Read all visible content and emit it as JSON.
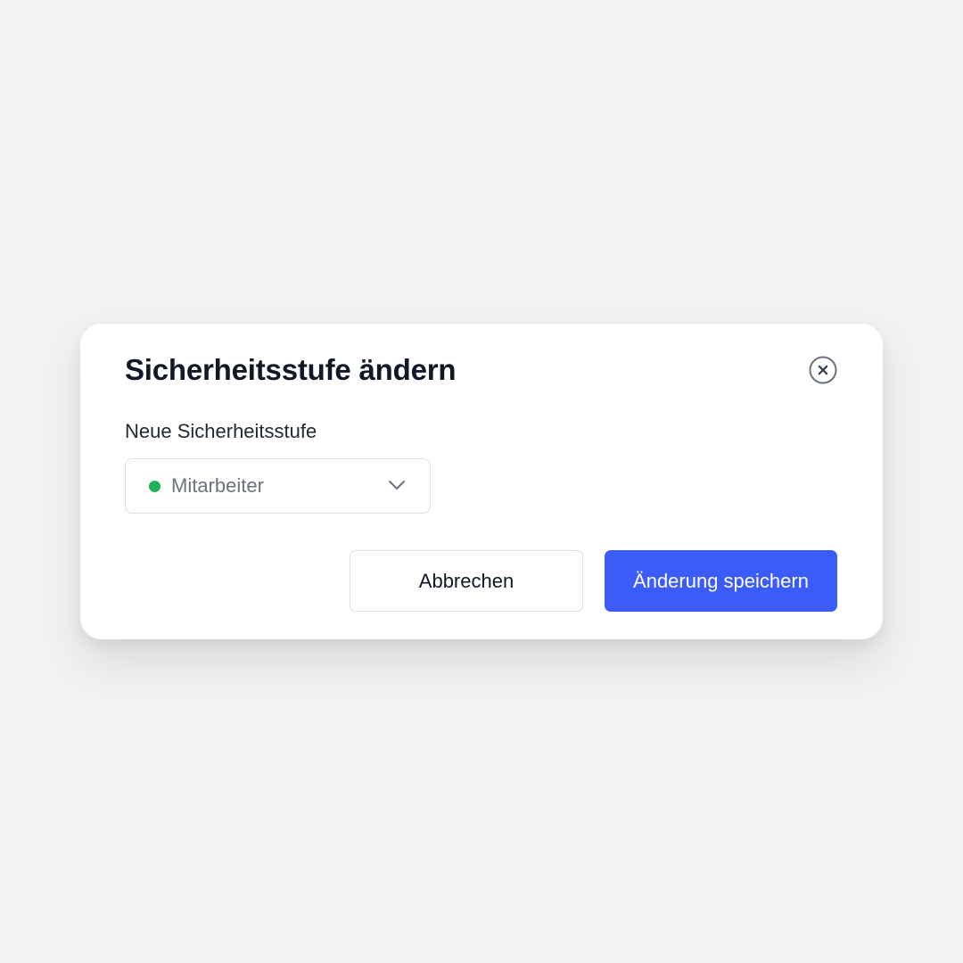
{
  "dialog": {
    "title": "Sicherheitsstufe ändern",
    "close_icon": "close-circle-icon"
  },
  "field": {
    "label": "Neue Sicherheitsstufe",
    "selected_value": "Mitarbeiter",
    "status_color": "#1eb25a",
    "dropdown_icon": "chevron-down-icon"
  },
  "actions": {
    "cancel_label": "Abbrechen",
    "save_label": "Änderung speichern"
  },
  "colors": {
    "background": "#f2f2f2",
    "primary": "#3b5bfb",
    "text": "#111827",
    "muted_text": "#6b7280",
    "status_green": "#1eb25a"
  }
}
